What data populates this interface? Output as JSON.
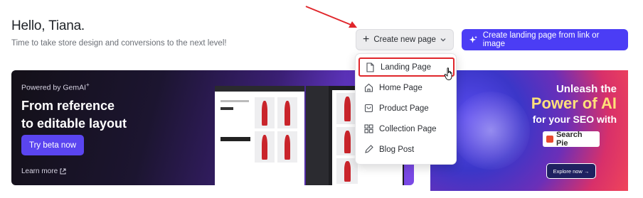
{
  "header": {
    "greeting": "Hello, Tiana.",
    "subtitle": "Time to take store design and conversions to the next level!"
  },
  "actions": {
    "create_new_page": "Create new page",
    "create_landing_from_link": "Create landing page from link or image"
  },
  "dropdown": {
    "items": [
      {
        "label": "Landing Page",
        "icon": "document-icon",
        "highlighted": true
      },
      {
        "label": "Home Page",
        "icon": "home-icon",
        "highlighted": false
      },
      {
        "label": "Product Page",
        "icon": "bag-icon",
        "highlighted": false
      },
      {
        "label": "Collection Page",
        "icon": "grid-icon",
        "highlighted": false
      },
      {
        "label": "Blog Post",
        "icon": "pencil-icon",
        "highlighted": false
      }
    ]
  },
  "banner_gemai": {
    "powered_by": "Powered by GemAI",
    "powered_sup": "+",
    "headline_line1": "From reference",
    "headline_line2": "to editable layout",
    "cta": "Try beta now",
    "learn_more": "Learn more"
  },
  "banner_searchpie": {
    "line1": "Unleash the",
    "line2": "Power of AI",
    "line3": "for your SEO with",
    "brand": "Search Pie",
    "cta": "Explore now →"
  },
  "colors": {
    "primary": "#4b3df5",
    "highlight_border": "#e0262b",
    "annotation_arrow": "#e0262b"
  }
}
